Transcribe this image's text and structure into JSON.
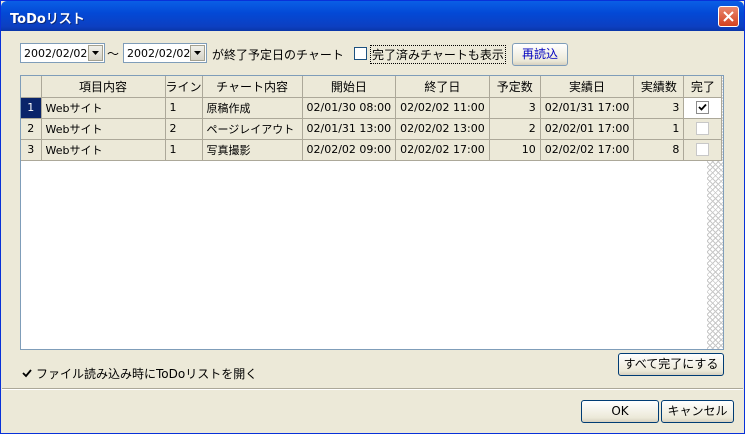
{
  "window": {
    "title": "ToDoリスト"
  },
  "filter": {
    "start_date": "2002/02/02",
    "tilde": "～",
    "end_date": "2002/02/02",
    "range_label": "が終了予定日のチャート",
    "show_completed_label": "完了済みチャートも表示",
    "show_completed_checked": false,
    "reload_label": "再読込"
  },
  "table": {
    "columns": [
      "",
      "項目内容",
      "ライン",
      "チャート内容",
      "開始日",
      "終了日",
      "予定数",
      "実績日",
      "実績数",
      "完了"
    ],
    "rows": [
      {
        "num": "1",
        "item": "Webサイト",
        "line": "1",
        "chart": "原稿作成",
        "start": "02/01/30 08:00",
        "end": "02/02/02 11:00",
        "planned": "3",
        "actual_date": "02/01/31 17:00",
        "actual": "3",
        "done": true
      },
      {
        "num": "2",
        "item": "Webサイト",
        "line": "2",
        "chart": "ページレイアウト",
        "start": "02/01/31 13:00",
        "end": "02/02/02 13:00",
        "planned": "2",
        "actual_date": "02/02/01 17:00",
        "actual": "1",
        "done": false
      },
      {
        "num": "3",
        "item": "Webサイト",
        "line": "1",
        "chart": "写真撮影",
        "start": "02/02/02 09:00",
        "end": "02/02/02 17:00",
        "planned": "10",
        "actual_date": "02/02/02 17:00",
        "actual": "8",
        "done": false
      }
    ]
  },
  "bottom": {
    "open_on_load_label": "ファイル読み込み時にToDoリストを開く",
    "open_on_load_checked": true,
    "complete_all_label": "すべて完了にする",
    "ok_label": "OK",
    "cancel_label": "キャンセル"
  },
  "colors": {
    "title_bar": "#0349d6",
    "selection": "#0a246a",
    "dialog_bg": "#ece9d8"
  },
  "icons": {
    "close": "close-icon",
    "dropdown": "chevron-down-icon",
    "check": "check-icon"
  }
}
